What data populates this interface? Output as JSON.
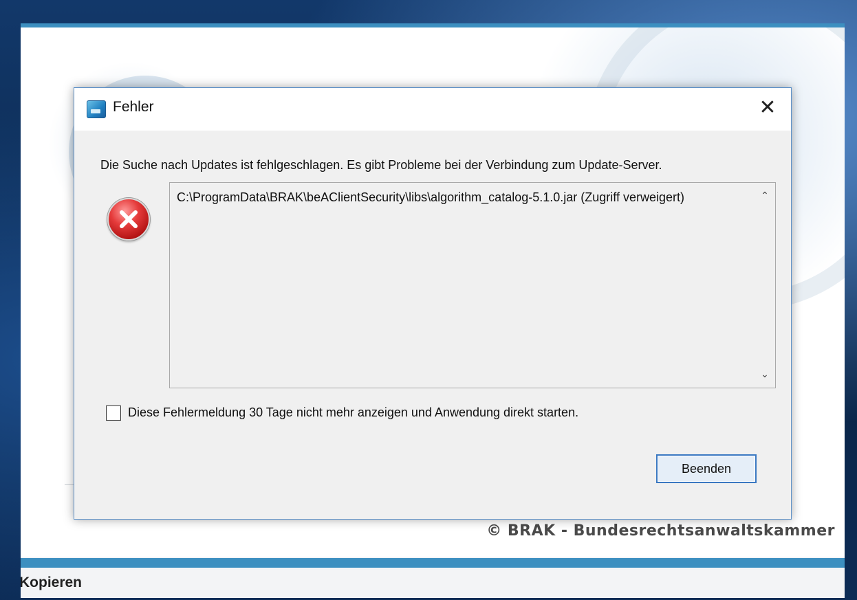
{
  "background_window": {
    "copyright": "© BRAK - Bundesrechtsanwaltskammer",
    "status_label": "Kopieren"
  },
  "dialog": {
    "title": "Fehler",
    "close_symbol": "✕",
    "message": "Die Suche nach Updates ist fehlgeschlagen. Es gibt Probleme bei der Verbindung zum Update-Server.",
    "details": "C:\\ProgramData\\BRAK\\beAClientSecurity\\libs\\algorithm_catalog-5.1.0.jar (Zugriff verweigert)",
    "scroll_up_symbol": "⌃",
    "scroll_down_symbol": "⌄",
    "checkbox_label": "Diese Fehlermeldung 30 Tage nicht mehr anzeigen und Anwendung direkt starten.",
    "checkbox_checked": false,
    "button_label": "Beenden",
    "icons": {
      "title": "app-icon",
      "status": "error-icon",
      "close": "close-icon"
    }
  },
  "colors": {
    "accent": "#3c8fc0",
    "dialog_border": "#5b8fc7",
    "error_red": "#d62b2b",
    "button_border": "#3a78c2"
  }
}
